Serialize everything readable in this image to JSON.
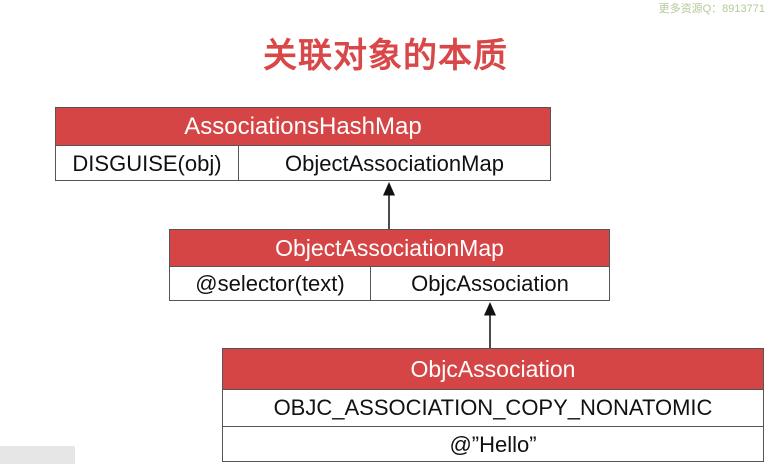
{
  "watermark": "更多资源Q：8913771",
  "title": "关联对象的本质",
  "associations_hash_map": {
    "header": "AssociationsHashMap",
    "key": "DISGUISE(obj)",
    "value": "ObjectAssociationMap"
  },
  "object_association_map": {
    "header": "ObjectAssociationMap",
    "key": "@selector(text)",
    "value": "ObjcAssociation"
  },
  "objc_association": {
    "header": "ObjcAssociation",
    "policy": "OBJC_ASSOCIATION_COPY_NONATOMIC",
    "value": "@”Hello”"
  },
  "colors": {
    "header_bg": "#d64545",
    "title": "#d94848",
    "border": "#555555"
  }
}
